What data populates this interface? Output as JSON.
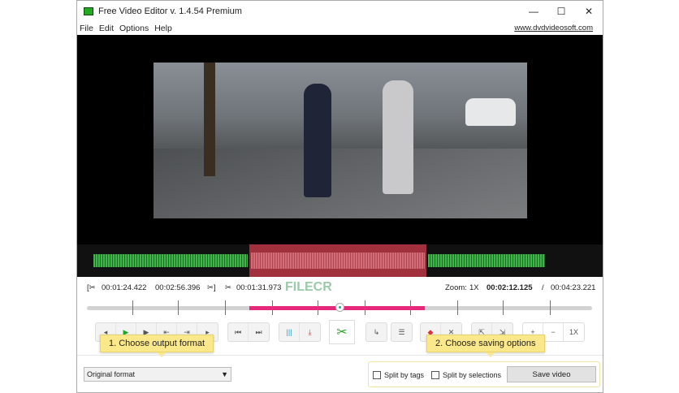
{
  "window": {
    "title": "Free Video Editor v. 1.4.54 Premium",
    "minimize": "—",
    "maximize": "☐",
    "close": "✕"
  },
  "menu": {
    "items": [
      "File",
      "Edit",
      "Options",
      "Help"
    ],
    "link": "www.dvdvideosoft.com"
  },
  "timeline": {
    "sel_start": "00:01:24.422",
    "sel_end": "00:02:56.396",
    "cut_time": "00:01:31.973",
    "zoom_label": "Zoom:",
    "zoom_value": "1X",
    "current": "00:02:12.125",
    "separator": "/",
    "total": "00:04:23.221",
    "watermark": "FILECR"
  },
  "controls": {
    "zoom_reset": "1X"
  },
  "tooltips": {
    "format": "1. Choose output format",
    "saving": "2. Choose saving options"
  },
  "output": {
    "format": "Original format",
    "split_tags": "Split by tags",
    "split_selections": "Split by selections",
    "save": "Save video"
  }
}
